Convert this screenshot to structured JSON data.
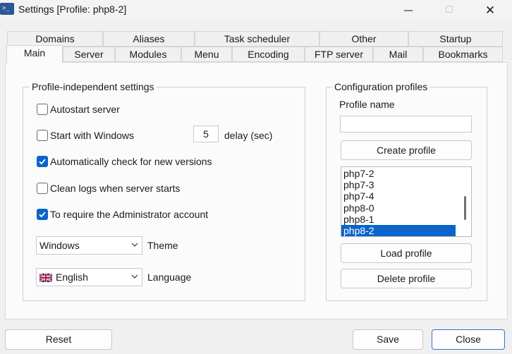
{
  "window": {
    "title": "Settings [Profile: php8-2]",
    "icon": "terminal-icon",
    "icon_glyph": ">_",
    "minimize_glyph": "—",
    "maximize_glyph": "☐",
    "close_glyph": "✕"
  },
  "tabs": {
    "row1": [
      "Domains",
      "Aliases",
      "Task scheduler",
      "Other",
      "Startup"
    ],
    "row2": [
      "Main",
      "Server",
      "Modules",
      "Menu",
      "Encoding",
      "FTP server",
      "Mail",
      "Bookmarks"
    ],
    "active": "Main"
  },
  "profile_independent": {
    "title": "Profile-independent settings",
    "autostart_server": {
      "label": "Autostart server",
      "checked": false
    },
    "start_with_windows": {
      "label": "Start with Windows",
      "checked": false
    },
    "delay_value": "5",
    "delay_label": "delay (sec)",
    "check_versions": {
      "label": "Automatically check for new versions",
      "checked": true
    },
    "clean_logs": {
      "label": "Clean logs when server starts",
      "checked": false
    },
    "require_admin": {
      "label": "To require the Administrator account",
      "checked": true
    },
    "theme_value": "Windows",
    "theme_label": "Theme",
    "language_value": "English",
    "language_label": "Language",
    "language_flag": "uk-flag-icon"
  },
  "config_profiles": {
    "title": "Configuration profiles",
    "profile_name_label": "Profile name",
    "profile_name_value": "",
    "create_button": "Create profile",
    "profiles": [
      "php7-2",
      "php7-3",
      "php7-4",
      "php8-0",
      "php8-1",
      "php8-2"
    ],
    "selected_profile": "php8-2",
    "load_button": "Load profile",
    "delete_button": "Delete profile"
  },
  "footer": {
    "reset": "Reset",
    "save": "Save",
    "close": "Close"
  },
  "colors": {
    "accent": "#0a64c9",
    "default_button_border": "#2f73c9"
  }
}
